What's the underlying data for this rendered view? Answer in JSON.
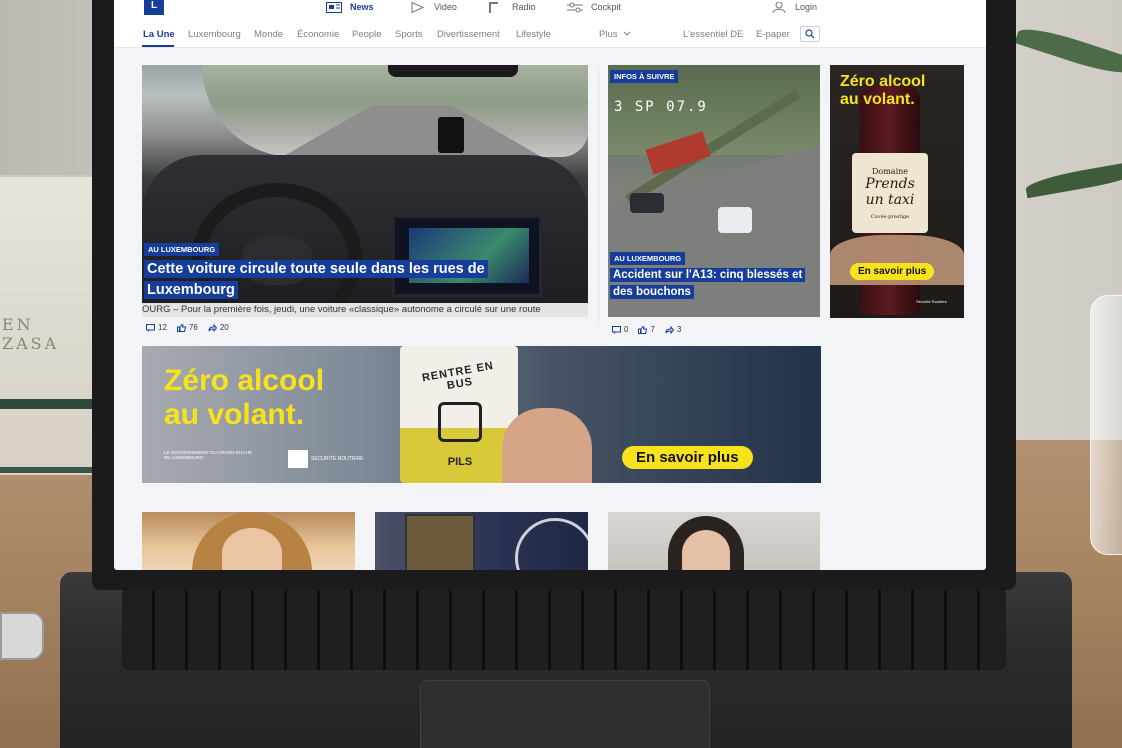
{
  "site": {
    "logo_letter": "L"
  },
  "topnav": {
    "items": [
      {
        "label": "News",
        "icon": "newspaper-icon",
        "active": true
      },
      {
        "label": "Video",
        "icon": "play-icon",
        "active": false
      },
      {
        "label": "Radio",
        "icon": "radio-icon",
        "active": false
      },
      {
        "label": "Cockpit",
        "icon": "sliders-icon",
        "active": false
      }
    ],
    "login_label": "Login"
  },
  "subnav": {
    "items": [
      {
        "label": "La Une",
        "active": true
      },
      {
        "label": "Luxembourg"
      },
      {
        "label": "Monde"
      },
      {
        "label": "Économie"
      },
      {
        "label": "People"
      },
      {
        "label": "Sports"
      },
      {
        "label": "Divertissement"
      },
      {
        "label": "Lifestyle"
      }
    ],
    "more_label": "Plus",
    "right_links": [
      "L'essentiel DE",
      "E-paper"
    ]
  },
  "hero": {
    "tag": "AU LUXEMBOURG",
    "headline_line1": "Cette voiture circule toute seule dans les rues de",
    "headline_line2": "Luxembourg",
    "teaser": "OURG – Pour la première fois, jeudi, une voiture «classique» autonome a circulé sur une route",
    "comments": "12",
    "likes": "76",
    "shares": "20"
  },
  "article2": {
    "top_tag": "INFOS À SUIVRE",
    "tag": "AU LUXEMBOURG",
    "headline_line1": "Accident sur l'A13: cinq blessés et",
    "headline_line2": "des bouchons",
    "camera_stamp": "3  SP  07.9",
    "comments": "0",
    "likes": "7",
    "shares": "3"
  },
  "side_ad": {
    "title_line1": "Zéro alcool",
    "title_line2": "au volant.",
    "label_line1": "Domaine",
    "label_line2": "Prends",
    "label_line3": "un taxi",
    "label_small": "Cuvée prestige",
    "cta": "En savoir plus",
    "brand": "Sécurité Routière"
  },
  "banner_ad": {
    "title_line1": "Zéro alcool",
    "title_line2": "au volant.",
    "bottle_text": "RENTRE EN BUS",
    "bottle_sub": "PILS",
    "cta": "En savoir plus",
    "gov_text": "LE GOUVERNEMENT DU GRAND-DUCHÉ DE LUXEMBOURG",
    "brand": "SÉCURITÉ ROUTIÈRE"
  },
  "book_title": "EN ZASA",
  "colors": {
    "brand_blue": "#173d9c",
    "ad_yellow": "#f7e21b"
  }
}
